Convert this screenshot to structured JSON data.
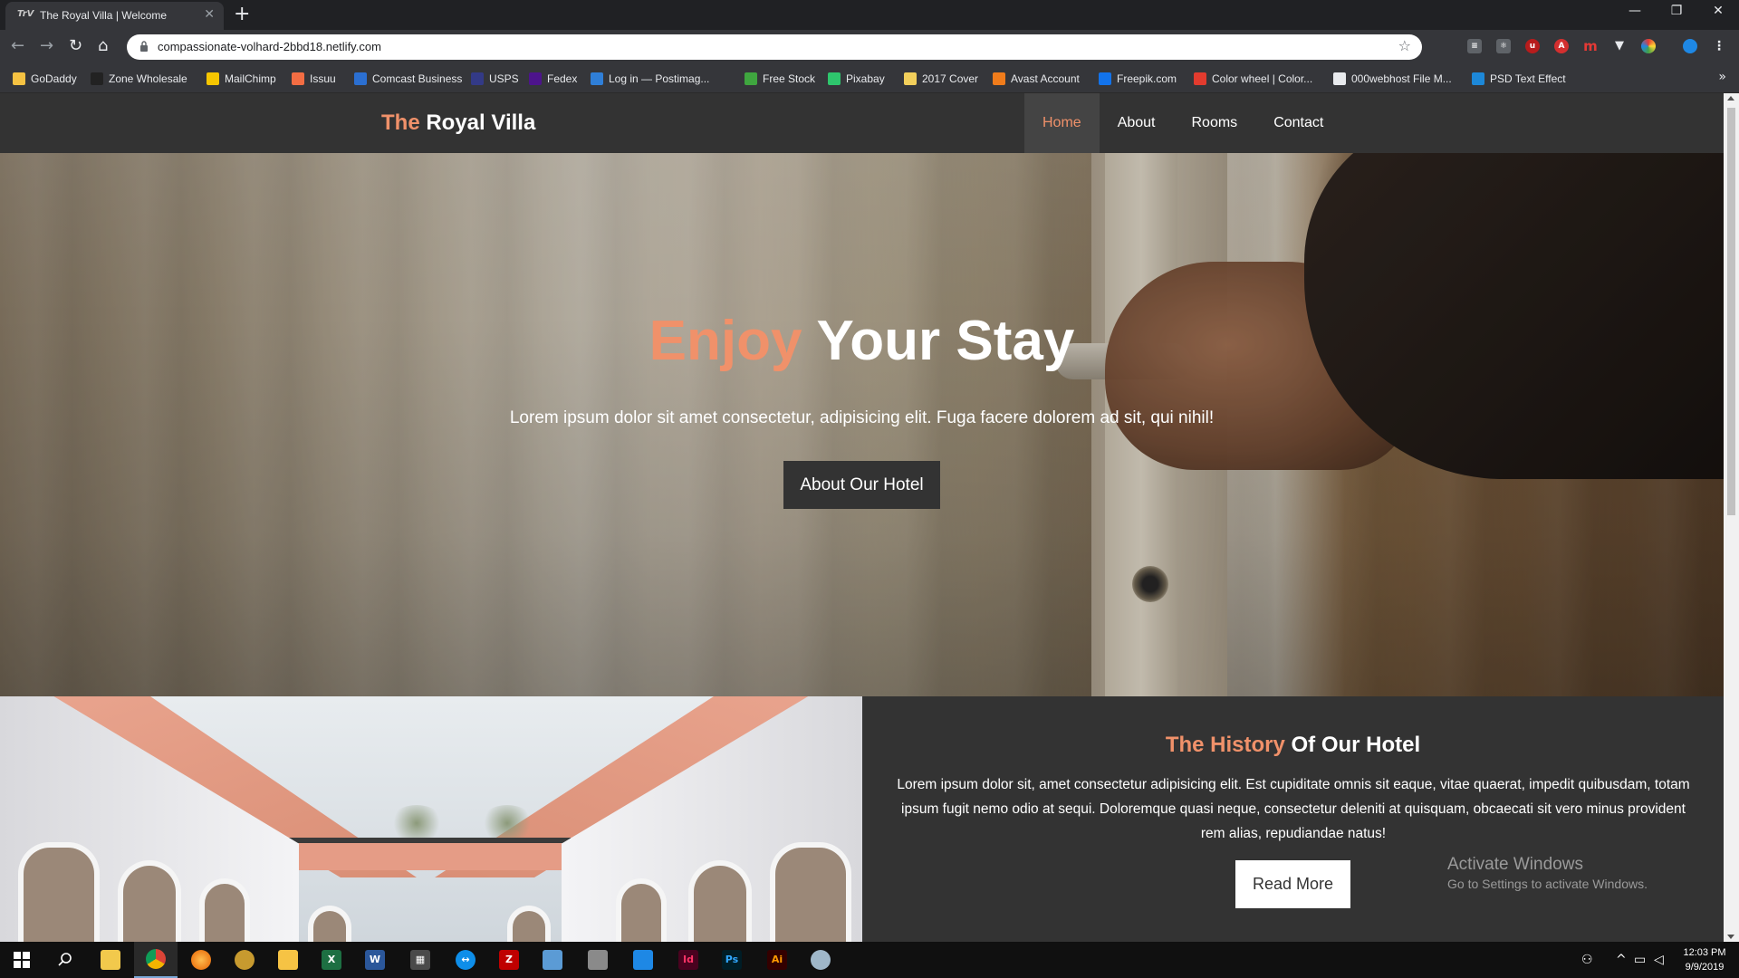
{
  "browser": {
    "tab_title": "The Royal Villa | Welcome",
    "tab_favicon": "TrV",
    "url": "compassionate-volhard-2bbd18.netlify.com"
  },
  "bookmarks": [
    {
      "label": "GoDaddy",
      "icon": "godaddy-icon",
      "color": "#f5c242"
    },
    {
      "label": "Zone Wholesale",
      "icon": "zone-icon",
      "color": "#222222"
    },
    {
      "label": "MailChimp",
      "icon": "mailchimp-icon",
      "color": "#f6c600"
    },
    {
      "label": "Issuu",
      "icon": "issuu-icon",
      "color": "#f36d43"
    },
    {
      "label": "Comcast Business",
      "icon": "comcast-icon",
      "color": "#2b6fd1"
    },
    {
      "label": "USPS",
      "icon": "usps-icon",
      "color": "#333a87"
    },
    {
      "label": "Fedex",
      "icon": "fedex-icon",
      "color": "#4d148c"
    },
    {
      "label": "Log in — Postimag...",
      "icon": "postimage-icon",
      "color": "#2f7fd8"
    },
    {
      "label": "Free Stock",
      "icon": "freestock-icon",
      "color": "#3fa63f"
    },
    {
      "label": "Pixabay",
      "icon": "pixabay-icon",
      "color": "#2ec66d"
    },
    {
      "label": "2017 Cover",
      "icon": "folder-icon",
      "color": "#f2cf5b"
    },
    {
      "label": "Avast Account",
      "icon": "avast-icon",
      "color": "#f07c1b"
    },
    {
      "label": "Freepik.com",
      "icon": "freepik-icon",
      "color": "#1273eb"
    },
    {
      "label": "Color wheel | Color...",
      "icon": "adobe-color-icon",
      "color": "#e23b2e"
    },
    {
      "label": "000webhost File M...",
      "icon": "webhost-icon",
      "color": "#e8eaed"
    },
    {
      "label": "PSD Text Effect",
      "icon": "psd-icon",
      "color": "#1d88d8"
    }
  ],
  "site": {
    "brand_accent": "The",
    "brand_rest": " Royal Villa",
    "nav": [
      {
        "label": "Home",
        "active": true
      },
      {
        "label": "About",
        "active": false
      },
      {
        "label": "Rooms",
        "active": false
      },
      {
        "label": "Contact",
        "active": false
      }
    ],
    "hero": {
      "title_accent": "Enjoy",
      "title_rest": " Your Stay",
      "subtitle": "Lorem ipsum dolor sit amet consectetur, adipisicing elit. Fuga facere dolorem ad sit, qui nihil!",
      "button": "About Our Hotel"
    },
    "history": {
      "title_accent": "The History",
      "title_rest": " Of Our Hotel",
      "body": "Lorem ipsum dolor sit, amet consectetur adipisicing elit. Est cupiditate omnis sit eaque, vitae quaerat, impedit quibusdam, totam ipsum fugit nemo odio at sequi. Doloremque quasi neque, consectetur deleniti at quisquam, obcaecati sit vero minus provident rem alias, repudiandae natus!",
      "button": "Read More"
    },
    "accent_color": "#f0916a"
  },
  "watermark": {
    "title": "Activate Windows",
    "subtitle": "Go to Settings to activate Windows."
  },
  "taskbar": {
    "time": "12:03 PM",
    "date": "9/9/2019"
  }
}
